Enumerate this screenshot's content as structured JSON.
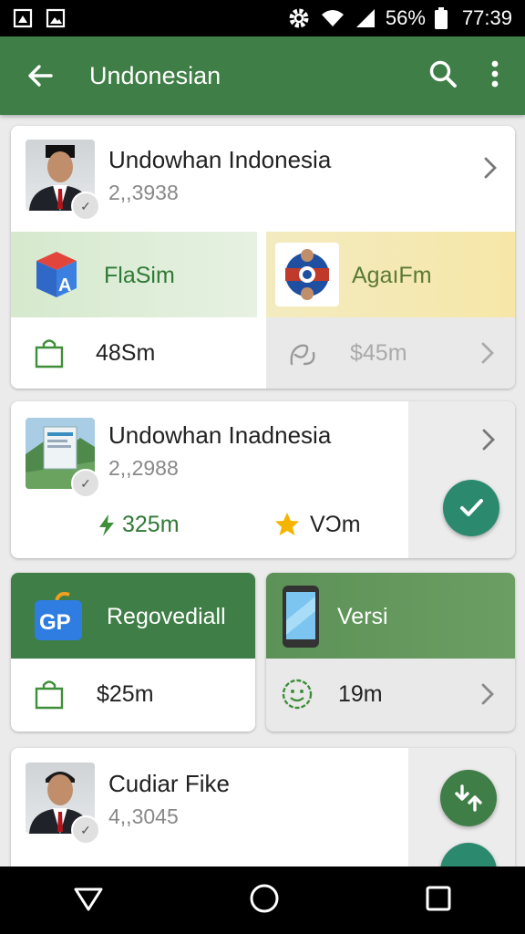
{
  "status_bar": {
    "battery": "56%",
    "time": "77:39"
  },
  "app_bar": {
    "title": "Undonesian"
  },
  "cards": {
    "profile1": {
      "name": "Undowhan Indonesia",
      "sub": "2,,3938"
    },
    "tile_flasim": {
      "title": "FlaSim",
      "price": "48Sm"
    },
    "tile_agaifm": {
      "title": "AgaıFm",
      "price": "$45m"
    },
    "profile2": {
      "name": "Undowhan Inadnesia",
      "sub": "2,,2988",
      "stat1": "325m",
      "stat2": "VƆm"
    },
    "tile_regove": {
      "title": "Regovediall",
      "price": "$25m",
      "logo_text": "GP"
    },
    "tile_versi": {
      "title": "Versi",
      "price": "19m"
    },
    "profile3": {
      "name": "Cudiar Fike",
      "sub": "4,,3045"
    }
  },
  "colors": {
    "primary": "#3f7e46",
    "teal": "#2b8a6e",
    "star": "#f5b400",
    "bolt": "#3f8f3a"
  }
}
